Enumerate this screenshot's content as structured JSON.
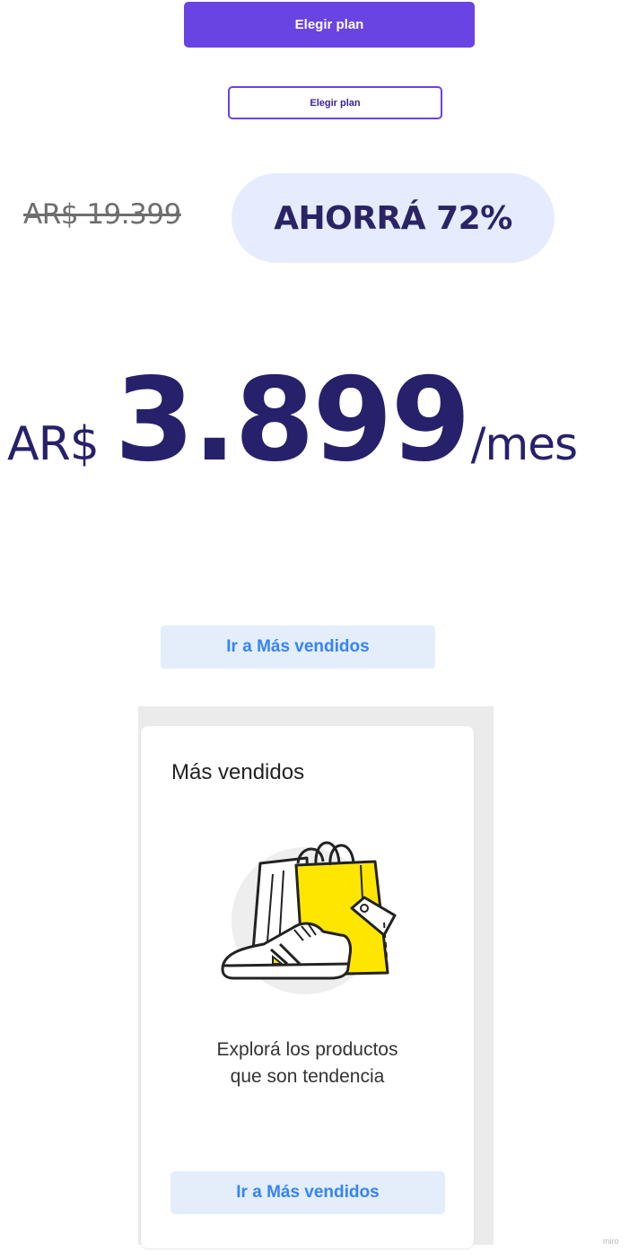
{
  "buttons": {
    "primary_label": "Elegir plan",
    "outline_label": "Elegir plan",
    "bestsellers_label": "Ir a Más vendidos"
  },
  "pricing": {
    "old_price": "AR$ 19.399",
    "savings": "AHORRÁ 72%",
    "currency": "AR$",
    "amount": "3.899",
    "period": "/mes"
  },
  "card": {
    "title": "Más vendidos",
    "description_line1": "Explorá los productos",
    "description_line2": "que son tendencia",
    "button_label": "Ir a Más vendidos",
    "illustration": "shopping-bag-sneaker-icon"
  },
  "watermark": "miro",
  "colors": {
    "primary": "#6a43e3",
    "price_text": "#27206b",
    "savings_pill": "#e6ecfd",
    "link_blue": "#3483fa",
    "soft_button_bg": "#e4eefb",
    "illustration_yellow": "#ffe600"
  }
}
